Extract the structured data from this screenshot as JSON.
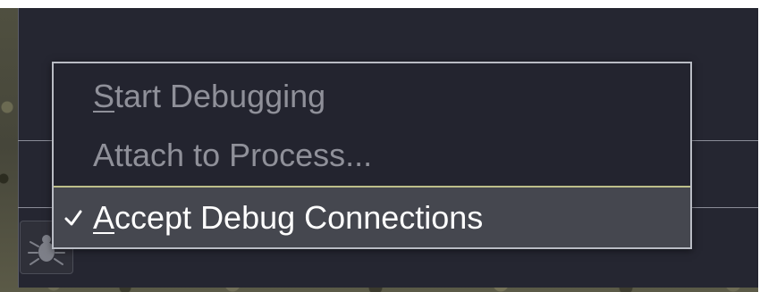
{
  "menu": {
    "items": [
      {
        "mnemonic": "S",
        "rest": "tart Debugging",
        "checked": false,
        "enabled": false
      },
      {
        "mnemonic": "",
        "rest": "Attach to Process...",
        "checked": false,
        "enabled": false
      },
      {
        "mnemonic": "A",
        "rest": "ccept Debug Connections",
        "checked": true,
        "enabled": true,
        "highlighted": true
      }
    ]
  },
  "toolbar": {
    "debug_icon": "bug-icon"
  },
  "colors": {
    "panel_bg": "#252631",
    "menu_bg": "#23242f",
    "menu_border": "#b9bcc4",
    "highlight_bg": "#45474f",
    "disabled_text": "#8f9099",
    "active_text": "#ffffff",
    "separator": "#bdbf8a"
  }
}
